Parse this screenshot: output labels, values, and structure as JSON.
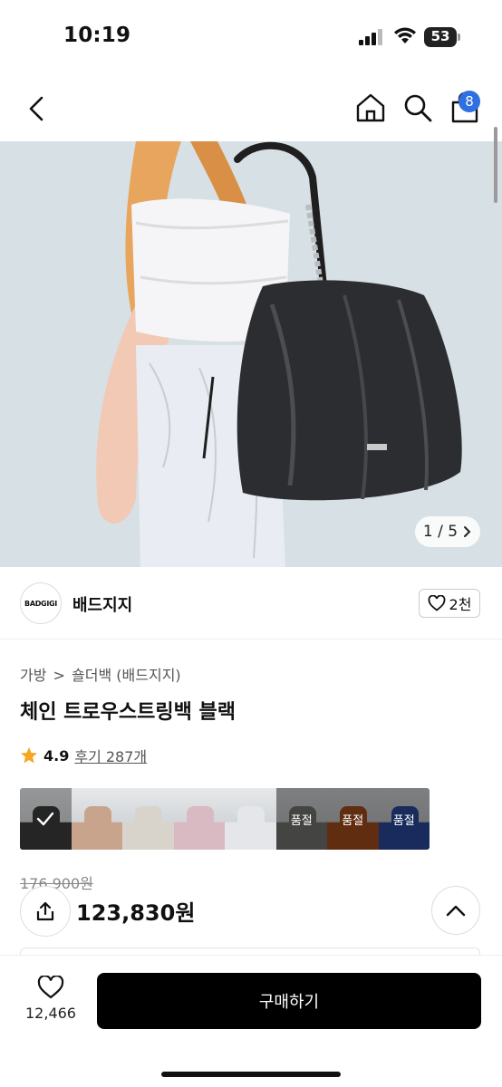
{
  "status_bar": {
    "time": "10:19",
    "battery": "53"
  },
  "header": {
    "cart_count": "8"
  },
  "gallery": {
    "counter": "1 / 5"
  },
  "brand": {
    "logo_text": "BADGIGI",
    "name": "배드지지",
    "likes": "2천"
  },
  "breadcrumb": [
    "가방",
    "숄더백 (배드지지)"
  ],
  "product": {
    "title": "체인 트로우스트링백 블랙",
    "rating": "4.9",
    "review_label": "후기 287개",
    "original_price": "176,900원",
    "price": "123,830원"
  },
  "options": [
    {
      "color": "#3a3a3a",
      "status": "selected"
    },
    {
      "color": "#c9a48c",
      "status": ""
    },
    {
      "color": "#d8d4cc",
      "status": ""
    },
    {
      "color": "#d9b9c2",
      "status": ""
    },
    {
      "color": "#e4e6ea",
      "status": ""
    },
    {
      "color": "#7d7f7a",
      "status": "품절"
    },
    {
      "color": "#b0531f",
      "status": "품절"
    },
    {
      "color": "#2c4fa8",
      "status": "품절"
    }
  ],
  "bottom_bar": {
    "wish_count": "12,466",
    "buy_label": "구매하기"
  },
  "colors": {
    "accent": "#2f6fdf",
    "buy_button": "#000000",
    "rating_star": "#f5a623"
  }
}
